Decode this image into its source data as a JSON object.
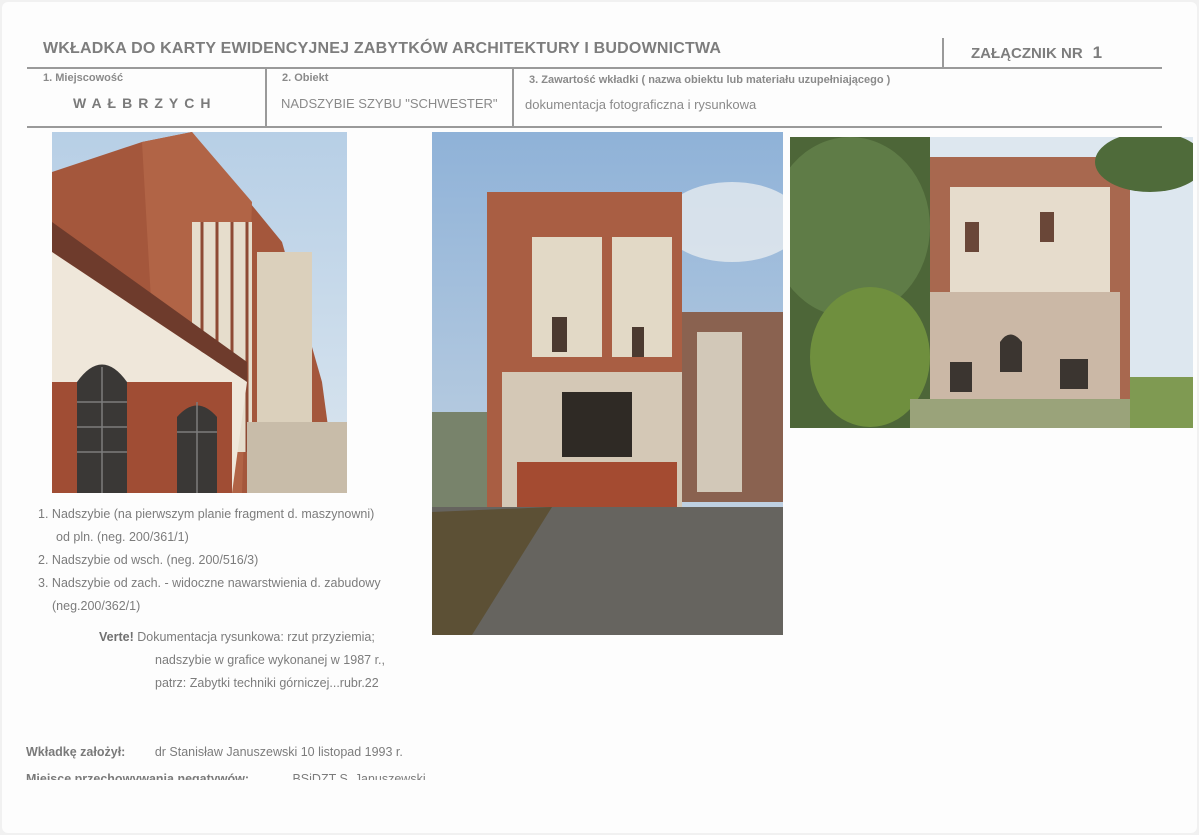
{
  "header": {
    "title": "WKŁADKA DO KARTY EWIDENCYJNEJ ZABYTKÓW ARCHITEKTURY I BUDOWNICTWA",
    "annex_label": "ZAŁĄCZNIK NR",
    "annex_number": "1"
  },
  "fields": [
    {
      "label": "1. Miejscowość",
      "value": "WAŁBRZYCH"
    },
    {
      "label": "2. Obiekt",
      "value": "NADSZYBIE SZYBU \"SCHWESTER\""
    },
    {
      "label": "3. Zawartość wkładki ( nazwa obiektu lub materiału uzupełniającego )",
      "value": "dokumentacja fotograficzna i rysunkowa"
    }
  ],
  "photos": [
    {
      "icon": "photo-1-brick-shaft-tower-detail"
    },
    {
      "icon": "photo-2-shaft-tower-east-view"
    },
    {
      "icon": "photo-3-shaft-tower-west-view"
    }
  ],
  "captions": [
    {
      "num": "1.",
      "lines": [
        "Nadszybie (na pierwszym planie fragment d. maszynowni)",
        "od pln. (neg. 200/361/1)"
      ]
    },
    {
      "num": "2.",
      "lines": [
        "Nadszybie od wsch. (neg. 200/516/3)"
      ]
    },
    {
      "num": "3.",
      "lines": [
        "Nadszybie od zach. - widoczne nawarstwienia d. zabudowy",
        "(neg.200/362/1)"
      ]
    }
  ],
  "note": {
    "label": "Verte!",
    "lines": [
      "Dokumentacja rysunkowa: rzut przyziemia;",
      "nadszybie w grafice wykonanej w 1987 r.,",
      "patrz: Zabytki techniki górniczej...rubr.22"
    ]
  },
  "footer": {
    "created_label": "Wkładkę założył:",
    "created_value": "dr Stanisław Januszewski 10 listopad 1993 r.",
    "storage_label": "Miejsce przechowywania negatywów:",
    "storage_value": "BSiDZT S. Januszewski"
  },
  "colors": {
    "text": "#7d7d7d",
    "rule": "#9a9a9a",
    "brick": "#a2533a",
    "sky": "#a9c6e2"
  }
}
